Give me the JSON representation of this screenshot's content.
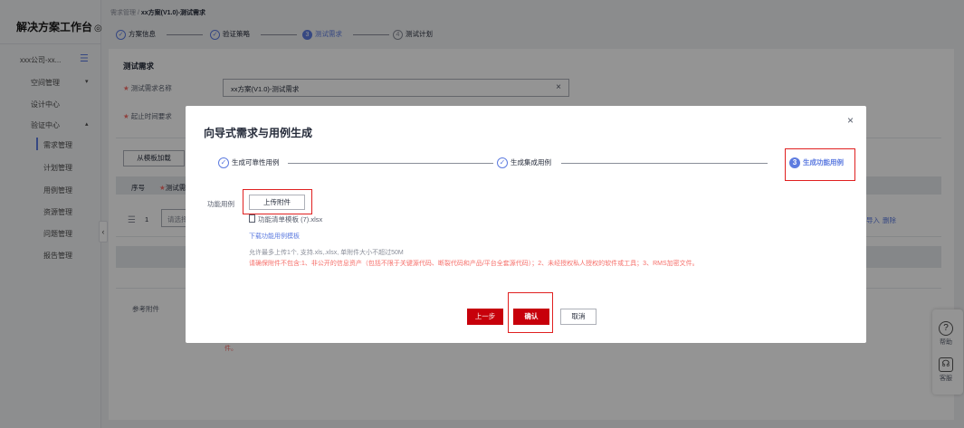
{
  "sidebar": {
    "title": "解决方案工作台",
    "title_icon": "hi-icon",
    "company": "xxx公司-xx...",
    "menu_icon": "☰",
    "items": [
      {
        "label": "空间管理",
        "caret": "▾"
      },
      {
        "label": "设计中心",
        "caret": ""
      },
      {
        "label": "验证中心",
        "caret": "▴"
      }
    ],
    "sub_items": [
      "需求管理",
      "计划管理",
      "用例管理",
      "资源管理",
      "问题管理",
      "报告管理"
    ],
    "collapse_glyph": "‹"
  },
  "breadcrumb": {
    "parent": "需求管理",
    "separator": " / ",
    "current": "xx方案(V1.0)-测试需求"
  },
  "top_steps": [
    {
      "num": "✓",
      "label": "方案信息",
      "state": "done"
    },
    {
      "num": "✓",
      "label": "验证策略",
      "state": "done"
    },
    {
      "num": "3",
      "label": "测试需求",
      "state": "active"
    },
    {
      "num": "4",
      "label": "测试计划",
      "state": "todo"
    }
  ],
  "form": {
    "section_title": "测试需求",
    "name_label": "测试需求名称",
    "name_value": "xx方案(V1.0)-测试需求",
    "clear_glyph": "×",
    "time_label": "起止时间要求",
    "required_mark": "★"
  },
  "table": {
    "template_button": "从模板加载",
    "headers": [
      "序号",
      "测试需"
    ],
    "row_num": "1",
    "row_placeholder": "请选择",
    "row_drag": "☰",
    "import_link": "导入",
    "delete_link": "删除",
    "ref_label": "参考附件",
    "warning_tail": "件。"
  },
  "help": {
    "help_label": "帮助",
    "service_label": "客服",
    "help_glyph": "?",
    "service_glyph": "☊"
  },
  "modal": {
    "title": "向导式需求与用例生成",
    "close_glyph": "×",
    "steps": [
      {
        "num": "✓",
        "label": "生成可靠性用例",
        "state": "done"
      },
      {
        "num": "✓",
        "label": "生成集成用例",
        "state": "done"
      },
      {
        "num": "3",
        "label": "生成功能用例",
        "state": "active"
      }
    ],
    "field_label": "功能用例",
    "upload_button": "上传附件",
    "file_name": "功能清单模板 (7).xlsx",
    "download_link": "下载功能用例模板",
    "hint": "允许最多上传1个, 支持.xls,.xlsx, 单附件大小不超过50M",
    "warning": "请确保附件不包含:1、非公开的信息资产（包括不限于关键源代码、断裂代码和产品/平台全套源代码）；2、未经授权私人授权的软件或工具；3、RMS加密文件。",
    "prev_button": "上一步",
    "confirm_button": "确认",
    "cancel_button": "取消"
  },
  "colors": {
    "accent": "#5e7ce0",
    "danger": "#c7000b",
    "highlight": "#e02020"
  }
}
